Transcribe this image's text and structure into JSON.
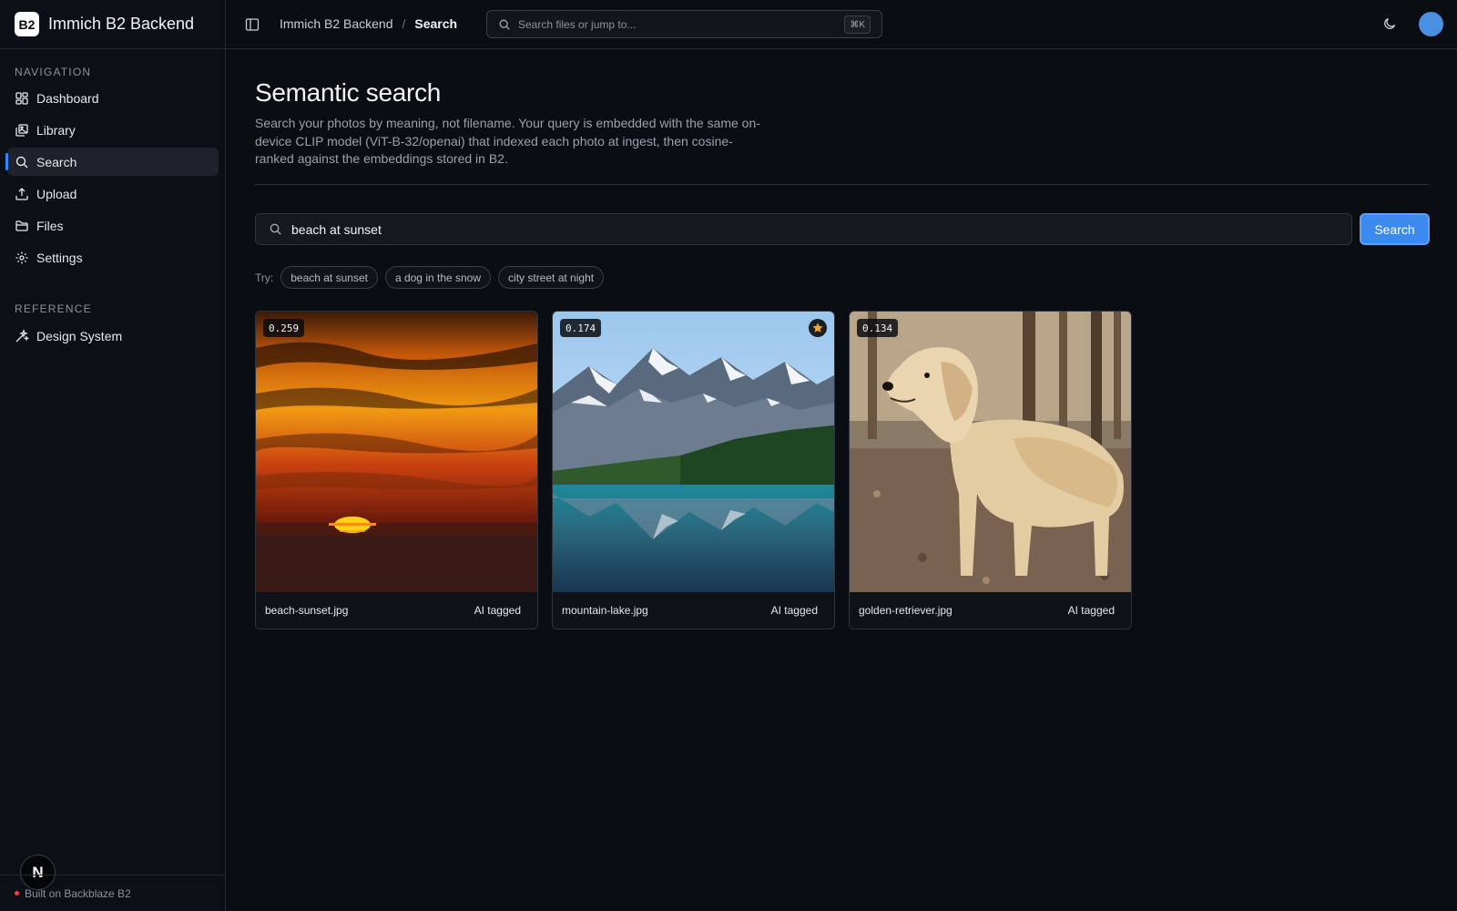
{
  "brand": {
    "logo": "B2",
    "name": "Immich B2 Backend"
  },
  "sidebar": {
    "sections": [
      {
        "title": "NAVIGATION"
      },
      {
        "title": "REFERENCE"
      }
    ],
    "items": [
      {
        "label": "Dashboard",
        "icon": "dashboard-icon"
      },
      {
        "label": "Library",
        "icon": "library-icon"
      },
      {
        "label": "Search",
        "icon": "search-icon",
        "active": true
      },
      {
        "label": "Upload",
        "icon": "upload-icon"
      },
      {
        "label": "Files",
        "icon": "folder-icon"
      },
      {
        "label": "Settings",
        "icon": "gear-icon"
      }
    ],
    "reference_items": [
      {
        "label": "Design System",
        "icon": "sparkles-icon"
      }
    ],
    "footer": "Built on Backblaze B2",
    "badge": "N"
  },
  "topbar": {
    "breadcrumb_root": "Immich B2 Backend",
    "breadcrumb_sep": "/",
    "breadcrumb_current": "Search",
    "search_placeholder": "Search files or jump to...",
    "shortcut": "⌘K"
  },
  "page": {
    "title": "Semantic search",
    "description": "Search your photos by meaning, not filename. Your query is embedded with the same on-device CLIP model (ViT-B-32/openai) that indexed each photo at ingest, then cosine-ranked against the embeddings stored in B2.",
    "query": "beach at sunset",
    "search_button": "Search",
    "try_label": "Try:",
    "suggestions": [
      "beach at sunset",
      "a dog in the snow",
      "city street at night"
    ]
  },
  "results": [
    {
      "score": "0.259",
      "filename": "beach-sunset.jpg",
      "tag": "AI tagged",
      "favorite": false
    },
    {
      "score": "0.174",
      "filename": "mountain-lake.jpg",
      "tag": "AI tagged",
      "favorite": true
    },
    {
      "score": "0.134",
      "filename": "golden-retriever.jpg",
      "tag": "AI tagged",
      "favorite": false
    }
  ],
  "colors": {
    "accent": "#3b8af0",
    "background": "#0a0d12",
    "favorite": "#f5a623"
  }
}
